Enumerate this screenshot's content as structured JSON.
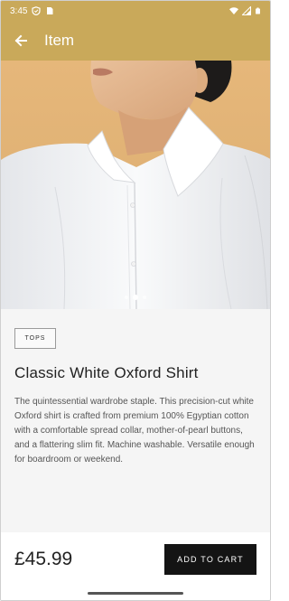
{
  "status_bar": {
    "time": "3:45"
  },
  "app_bar": {
    "title": "Item"
  },
  "carousel": {
    "page_count": 3,
    "active_index": 1
  },
  "product": {
    "category": "TOPS",
    "title": "Classic White Oxford Shirt",
    "description": "The quintessential wardrobe staple. This precision-cut white Oxford shirt is crafted from premium 100% Egyptian cotton with a comfortable spread collar, mother-of-pearl buttons, and a flattering slim fit. Machine washable. Versatile enough for boardroom or weekend.",
    "price": "£45.99"
  },
  "actions": {
    "add_to_cart": "ADD TO CART"
  },
  "colors": {
    "accent": "#c9a95a",
    "button": "#141414",
    "image_background": "#dfb174"
  },
  "icons": {
    "back": "arrow-left-icon",
    "status": [
      "shield-icon",
      "sim-card-icon",
      "wifi-icon",
      "signal-icon",
      "battery-icon"
    ]
  }
}
